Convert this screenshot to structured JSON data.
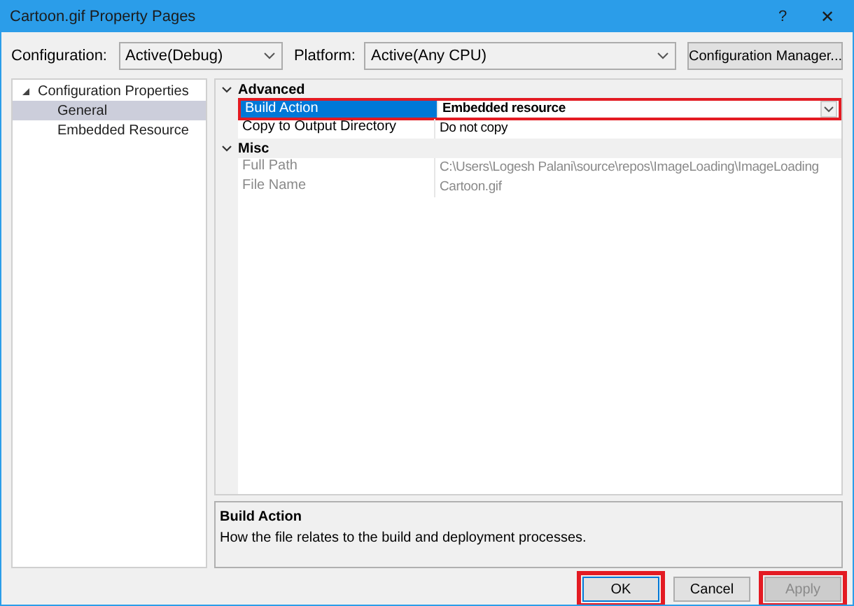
{
  "window": {
    "title": "Cartoon.gif Property Pages",
    "help": "?",
    "close": "✕"
  },
  "configuration": {
    "label": "Configuration:",
    "value": "Active(Debug)"
  },
  "platform": {
    "label": "Platform:",
    "value": "Active(Any CPU)"
  },
  "config_manager_button": "Configuration Manager...",
  "tree": [
    {
      "label": "Configuration Properties",
      "expanded": true,
      "selected": false,
      "children": [
        {
          "label": "General",
          "selected": true
        },
        {
          "label": "Embedded Resource",
          "selected": false
        }
      ]
    }
  ],
  "grid": [
    {
      "category": "Advanced",
      "expanded": true,
      "properties": [
        {
          "name": "Build Action",
          "value": "Embedded resource",
          "selected": true,
          "highlighted": true,
          "disabled": false
        },
        {
          "name": "Copy to Output Directory",
          "value": "Do not copy",
          "selected": false,
          "highlighted": false,
          "disabled": false
        }
      ]
    },
    {
      "category": "Misc",
      "expanded": true,
      "properties": [
        {
          "name": "Full Path",
          "value": "C:\\Users\\Logesh Palani\\source\\repos\\ImageLoading\\ImageLoading",
          "selected": false,
          "highlighted": false,
          "disabled": true
        },
        {
          "name": "File Name",
          "value": "Cartoon.gif",
          "selected": false,
          "highlighted": false,
          "disabled": true
        }
      ]
    }
  ],
  "description": {
    "title": "Build Action",
    "text": "How the file relates to the build and deployment processes."
  },
  "buttons": [
    {
      "label": "OK",
      "disabled": false,
      "highlighted": true,
      "default": true
    },
    {
      "label": "Cancel",
      "disabled": false,
      "highlighted": false,
      "default": false
    },
    {
      "label": "Apply",
      "disabled": true,
      "highlighted": true,
      "default": false
    }
  ]
}
